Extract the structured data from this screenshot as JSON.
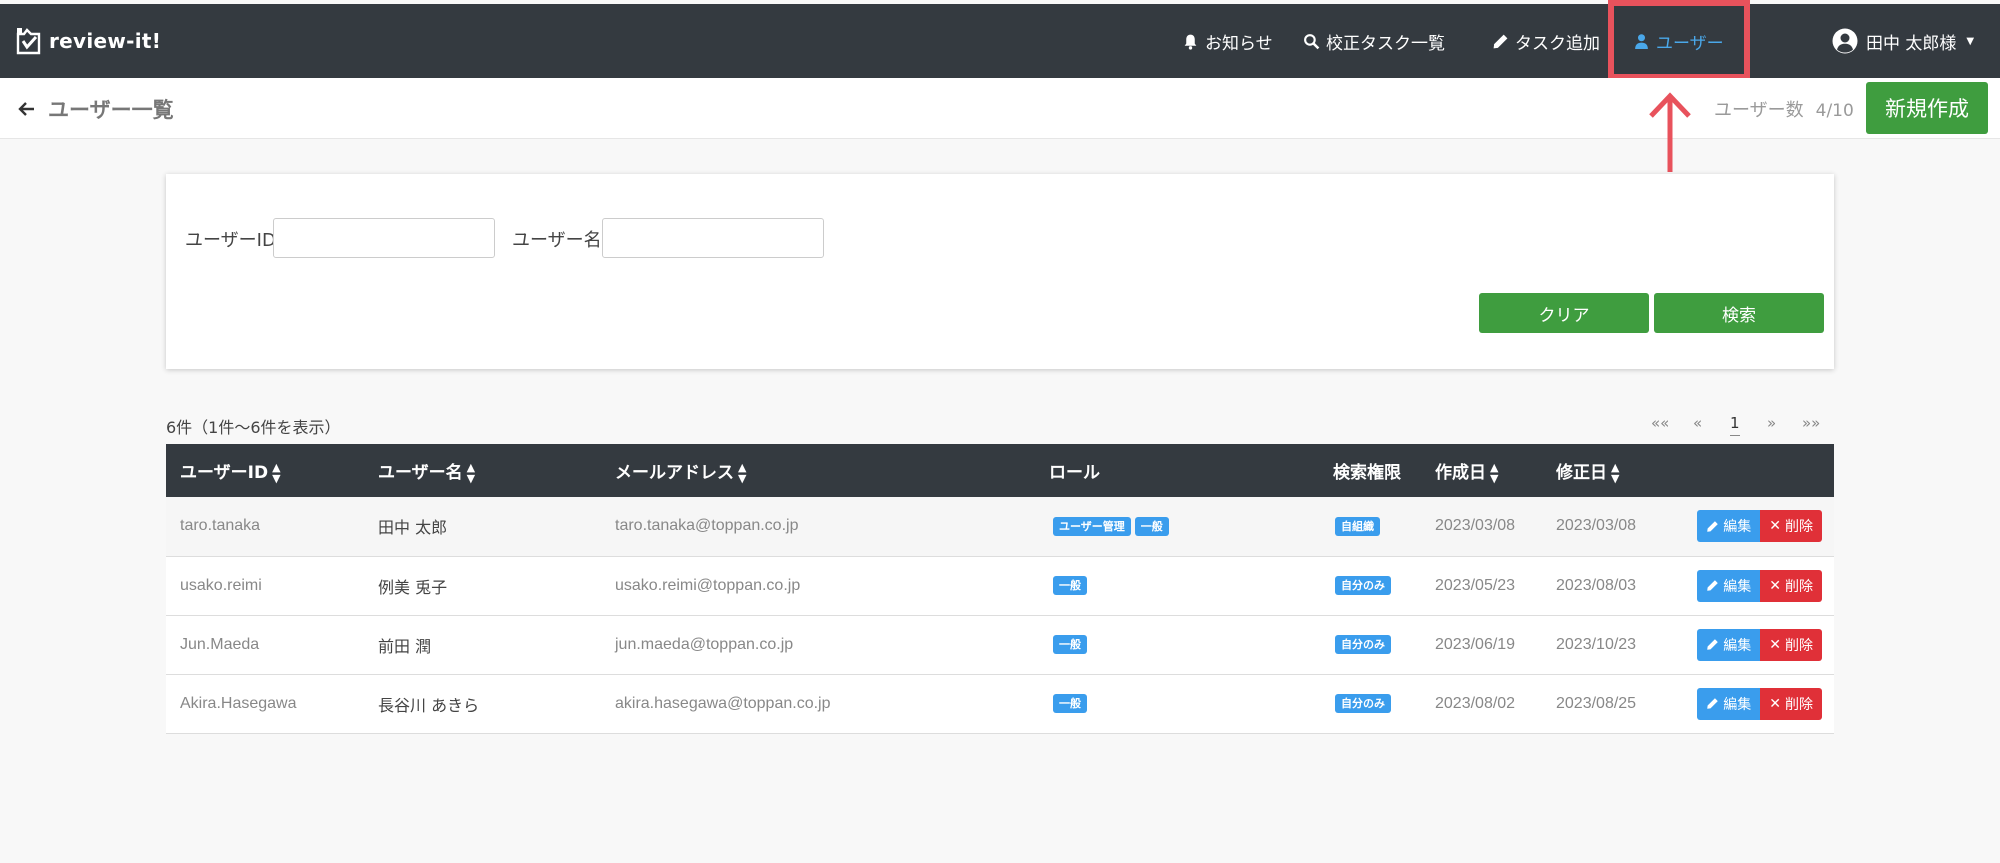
{
  "navbar": {
    "brand": "review-it!",
    "items": [
      {
        "label": "お知らせ",
        "icon": "bell-icon"
      },
      {
        "label": "校正タスク一覧",
        "icon": "search-icon"
      },
      {
        "label": "タスク追加",
        "icon": "pencil-icon"
      },
      {
        "label": "ユーザー",
        "icon": "user-icon",
        "active": true
      }
    ],
    "user_name": "田中 太郎様"
  },
  "page_header": {
    "title": "ユーザー一覧",
    "user_count_label": "ユーザー数",
    "user_count_value": "4/10",
    "new_button": "新規作成"
  },
  "search": {
    "user_id_label": "ユーザーID",
    "user_id_value": "",
    "user_name_label": "ユーザー名",
    "user_name_value": "",
    "clear_button": "クリア",
    "search_button": "検索"
  },
  "results": {
    "summary": "6件（1件〜6件を表示）",
    "pagination": {
      "first": "««",
      "prev": "«",
      "current": "1",
      "next": "»",
      "last": "»»"
    }
  },
  "table": {
    "columns": [
      "ユーザーID",
      "ユーザー名",
      "メールアドレス",
      "ロール",
      "検索権限",
      "作成日",
      "修正日"
    ],
    "edit_label": "編集",
    "delete_label": "削除",
    "rows": [
      {
        "id": "taro.tanaka",
        "name": "田中 太郎",
        "email": "taro.tanaka@toppan.co.jp",
        "roles": [
          "ユーザー管理",
          "一般"
        ],
        "scope": "自組織",
        "created": "2023/03/08",
        "updated": "2023/03/08"
      },
      {
        "id": "usako.reimi",
        "name": "例美 兎子",
        "email": "usako.reimi@toppan.co.jp",
        "roles": [
          "一般"
        ],
        "scope": "自分のみ",
        "created": "2023/05/23",
        "updated": "2023/08/03"
      },
      {
        "id": "Jun.Maeda",
        "name": "前田 潤",
        "email": "jun.maeda@toppan.co.jp",
        "roles": [
          "一般"
        ],
        "scope": "自分のみ",
        "created": "2023/06/19",
        "updated": "2023/10/23"
      },
      {
        "id": "Akira.Hasegawa",
        "name": "長谷川 あきら",
        "email": "akira.hasegawa@toppan.co.jp",
        "roles": [
          "一般"
        ],
        "scope": "自分のみ",
        "created": "2023/08/02",
        "updated": "2023/08/25"
      }
    ]
  },
  "colors": {
    "navbar": "#343a40",
    "accent_blue": "#3a9ded",
    "success_green": "#3f9d3f",
    "danger_red": "#e03038",
    "highlight": "#e8525c"
  }
}
